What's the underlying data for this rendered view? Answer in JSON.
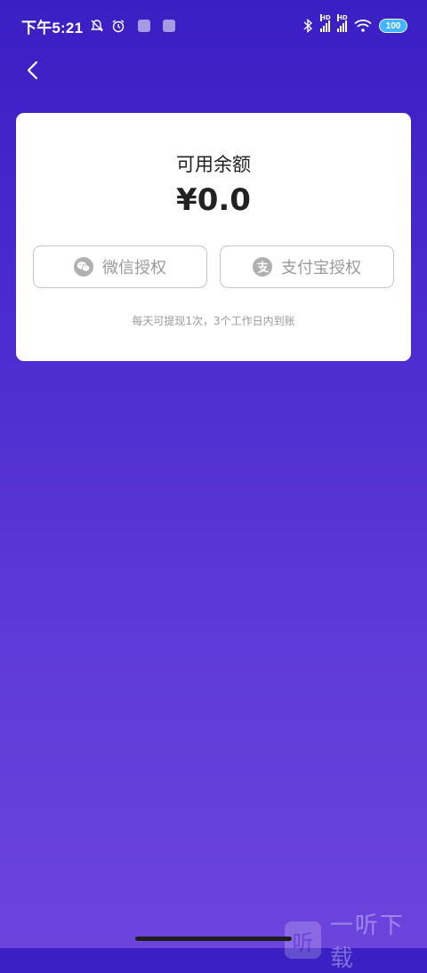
{
  "status_bar": {
    "time": "下午5:21",
    "hd1": "HD",
    "hd2": "HD",
    "battery": "100"
  },
  "nav": {
    "back_icon": "chevron-left-icon"
  },
  "card": {
    "balance_label": "可用余额",
    "balance_amount": "¥0.0",
    "wechat_button_label": "微信授权",
    "alipay_button_label": "支付宝授权",
    "note": "每天可提现1次，3个工作日内到账"
  },
  "watermark": {
    "logo_char": "听",
    "text": "一听下载"
  },
  "colors": {
    "gradient_top": "#3a1fc4",
    "gradient_bottom": "#6b44dc",
    "card_bg": "#ffffff",
    "button_border": "#c4c4c4",
    "muted_text": "#9a9a9a",
    "battery": "#3fb6ff"
  }
}
